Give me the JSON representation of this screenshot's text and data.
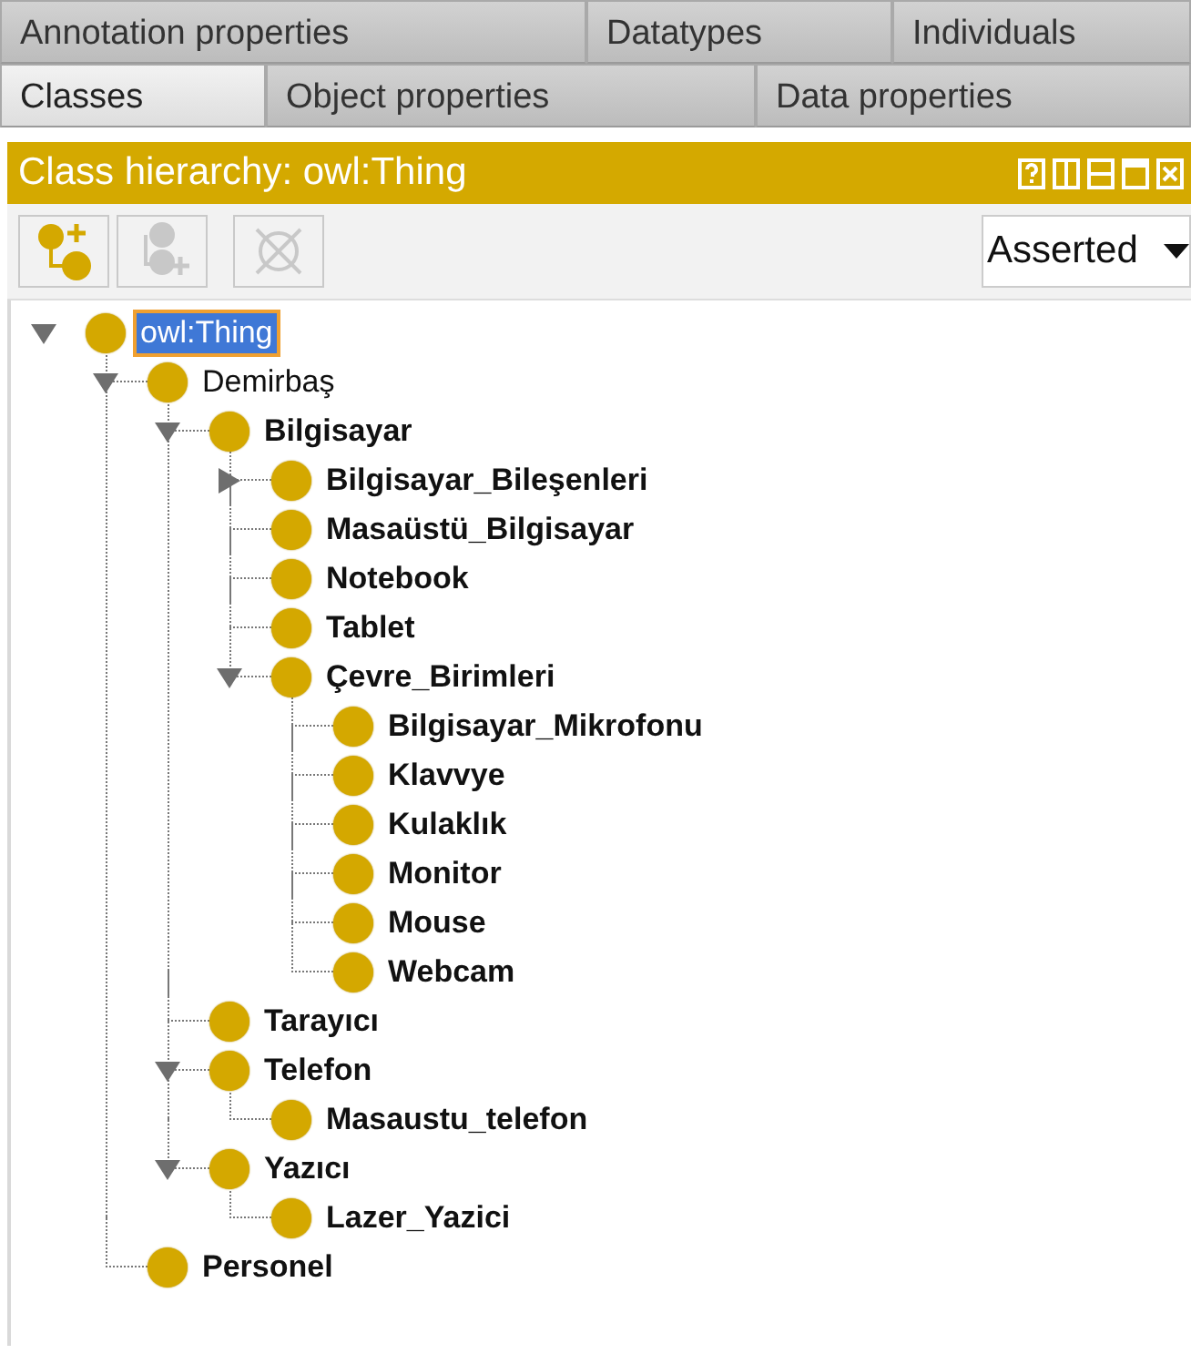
{
  "tabs": [
    [
      {
        "label": "Annotation properties",
        "selected": false
      },
      {
        "label": "Datatypes",
        "selected": false
      },
      {
        "label": "Individuals",
        "selected": false
      }
    ],
    [
      {
        "label": "Classes",
        "selected": true
      },
      {
        "label": "Object properties",
        "selected": false
      },
      {
        "label": "Data properties",
        "selected": false
      }
    ]
  ],
  "panel": {
    "title": "Class hierarchy: owl:Thing"
  },
  "toolbar": [
    {
      "kind": "add-subclass",
      "disabled": false
    },
    {
      "kind": "add-sibling",
      "disabled": true
    },
    {
      "kind": "delete",
      "disabled": true
    }
  ],
  "view_select": {
    "value": "Asserted"
  },
  "tree": [
    {
      "label": "owl:Thing",
      "bold": false,
      "selected": true,
      "expanded": true,
      "children": [
        {
          "label": "Demirbaş",
          "bold": false,
          "selected": false,
          "expanded": true,
          "children": [
            {
              "label": "Bilgisayar",
              "bold": true,
              "selected": false,
              "expanded": true,
              "children": [
                {
                  "label": "Bilgisayar_Bileşenleri",
                  "bold": true,
                  "selected": false,
                  "expanded": false
                },
                {
                  "label": "Masaüstü_Bilgisayar",
                  "bold": true,
                  "selected": false
                },
                {
                  "label": "Notebook",
                  "bold": true,
                  "selected": false
                },
                {
                  "label": "Tablet",
                  "bold": true,
                  "selected": false
                },
                {
                  "label": "Çevre_Birimleri",
                  "bold": true,
                  "selected": false,
                  "expanded": true,
                  "children": [
                    {
                      "label": "Bilgisayar_Mikrofonu",
                      "bold": true,
                      "selected": false
                    },
                    {
                      "label": "Klavvye",
                      "bold": true,
                      "selected": false
                    },
                    {
                      "label": "Kulaklık",
                      "bold": true,
                      "selected": false
                    },
                    {
                      "label": "Monitor",
                      "bold": true,
                      "selected": false
                    },
                    {
                      "label": "Mouse",
                      "bold": true,
                      "selected": false
                    },
                    {
                      "label": "Webcam",
                      "bold": true,
                      "selected": false
                    }
                  ]
                }
              ]
            },
            {
              "label": "Tarayıcı",
              "bold": true,
              "selected": false
            },
            {
              "label": "Telefon",
              "bold": true,
              "selected": false,
              "expanded": true,
              "children": [
                {
                  "label": "Masaustu_telefon",
                  "bold": true,
                  "selected": false
                }
              ]
            },
            {
              "label": "Yazıcı",
              "bold": true,
              "selected": false,
              "expanded": true,
              "children": [
                {
                  "label": "Lazer_Yazici",
                  "bold": true,
                  "selected": false
                }
              ]
            }
          ]
        },
        {
          "label": "Personel",
          "bold": true,
          "selected": false
        }
      ]
    }
  ]
}
